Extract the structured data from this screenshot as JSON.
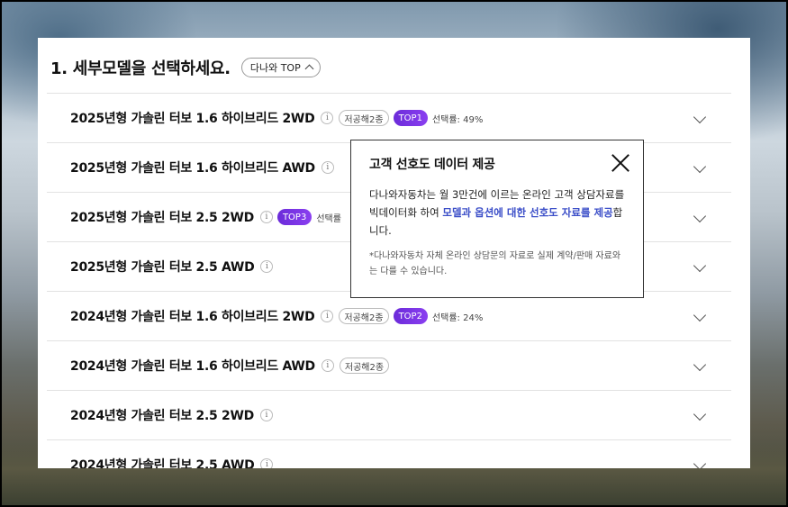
{
  "heading": {
    "title": "1. 세부모델을 선택하세요.",
    "top_button": "다나와 TOP"
  },
  "models": [
    {
      "name": "2025년형 가솔린 터보 1.6 하이브리드 2WD",
      "info": "i",
      "tag": "저공해2종",
      "top": "TOP1",
      "rate": "선택률: 49%"
    },
    {
      "name": "2025년형 가솔린 터보 1.6 하이브리드 AWD",
      "info": "i",
      "tag": "",
      "top": "",
      "rate": ""
    },
    {
      "name": "2025년형 가솔린 터보 2.5 2WD",
      "info": "i",
      "tag": "",
      "top": "TOP3",
      "rate": "선택률"
    },
    {
      "name": "2025년형 가솔린 터보 2.5 AWD",
      "info": "i",
      "tag": "",
      "top": "",
      "rate": ""
    },
    {
      "name": "2024년형 가솔린 터보 1.6 하이브리드 2WD",
      "info": "i",
      "tag": "저공해2종",
      "top": "TOP2",
      "rate": "선택률: 24%"
    },
    {
      "name": "2024년형 가솔린 터보 1.6 하이브리드 AWD",
      "info": "i",
      "tag": "저공해2종",
      "top": "",
      "rate": ""
    },
    {
      "name": "2024년형 가솔린 터보 2.5 2WD",
      "info": "i",
      "tag": "",
      "top": "",
      "rate": ""
    },
    {
      "name": "2024년형 가솔린 터보 2.5 AWD",
      "info": "i",
      "tag": "",
      "top": "",
      "rate": ""
    }
  ],
  "popup": {
    "title": "고객 선호도 데이터 제공",
    "body_prefix": "다나와자동차는 월 3만건에 이르는 온라인 고객 상담자료를 빅데이터화 하여 ",
    "body_highlight": "모델과 옵션에 대한 선호도 자료를 제공",
    "body_suffix": "합니다.",
    "note": "*다나와자동차 자체 온라인 상담문의 자료로 실제 계약/판매 자료와는 다를 수 있습니다."
  },
  "colors": {
    "top_badge": "#7a35e8",
    "highlight_text": "#3b4ec8"
  }
}
